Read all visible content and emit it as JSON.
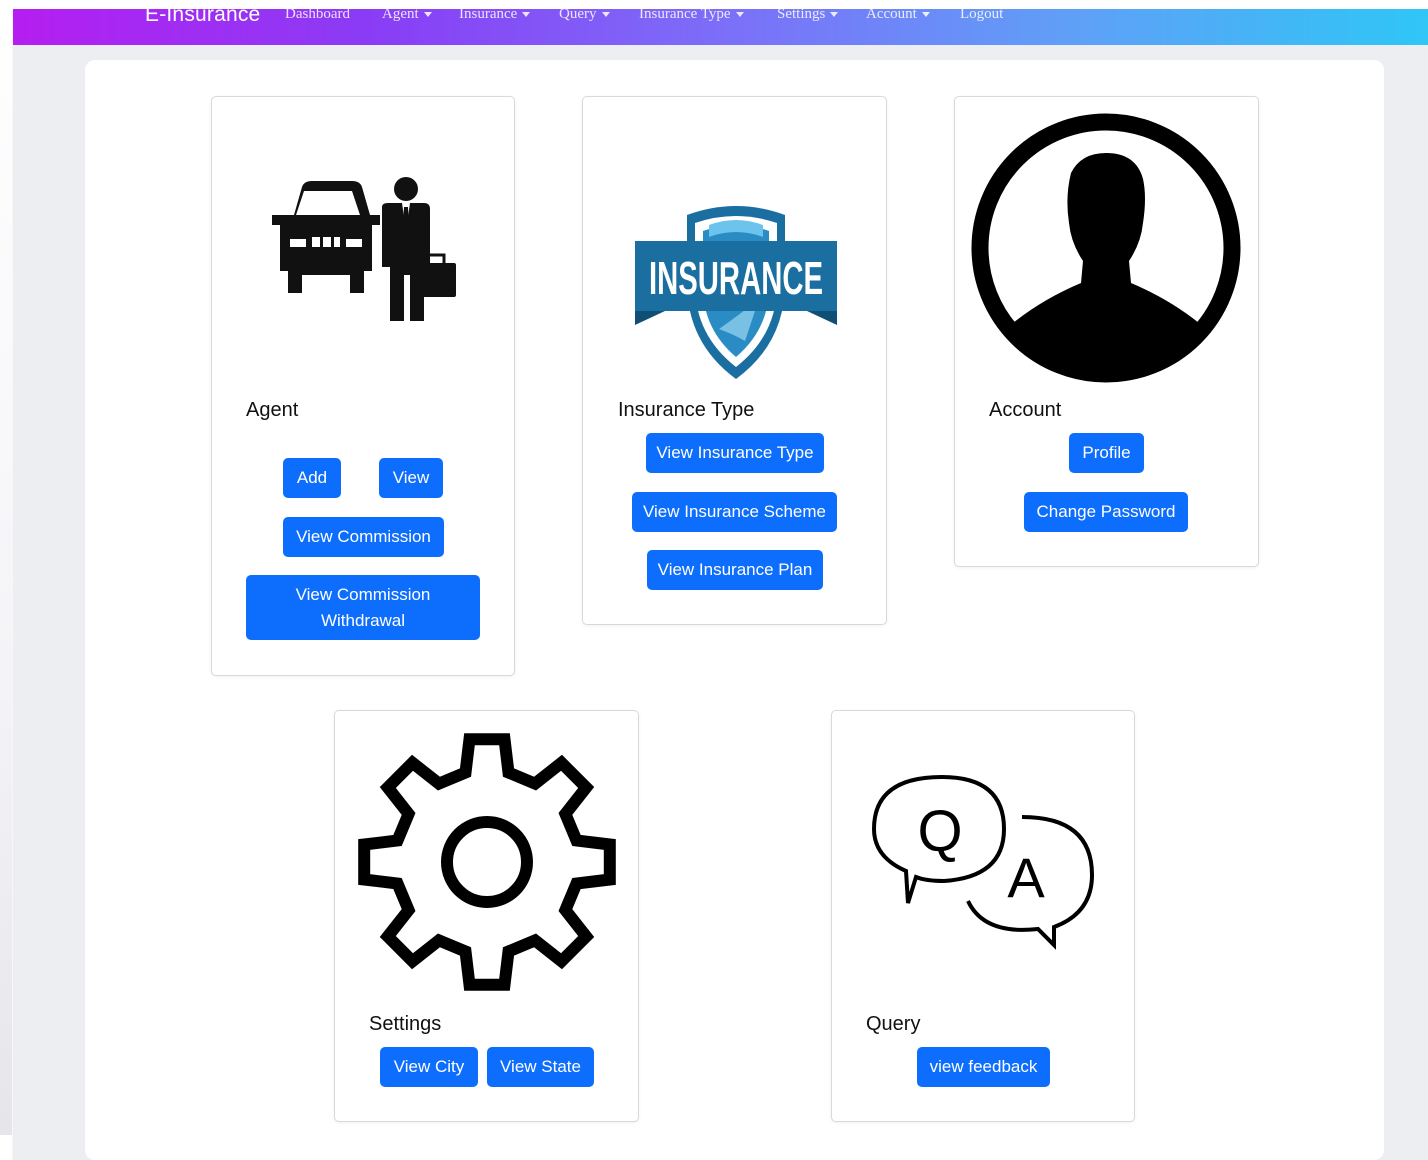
{
  "navbar": {
    "brand": "E-Insurance",
    "links": [
      {
        "label": "Dashboard",
        "dropdown": false
      },
      {
        "label": "Agent",
        "dropdown": true
      },
      {
        "label": "Insurance",
        "dropdown": true
      },
      {
        "label": "Query",
        "dropdown": true
      },
      {
        "label": "Insurance Type",
        "dropdown": true
      },
      {
        "label": "Settings",
        "dropdown": true
      },
      {
        "label": "Account",
        "dropdown": true
      },
      {
        "label": "Logout",
        "dropdown": false
      }
    ]
  },
  "cards": {
    "agent": {
      "title": "Agent",
      "icon": "car-agent-icon",
      "buttons": {
        "add": "Add",
        "view": "View",
        "view_commission": "View Commission",
        "withdrawal_line1": "View Commission",
        "withdrawal_line2": "Withdrawal"
      }
    },
    "insurance_type": {
      "title": "Insurance Type",
      "icon": "insurance-shield-icon",
      "logo_text": "INSURANCE",
      "buttons": {
        "view_type": "View Insurance Type",
        "view_scheme": "View Insurance Scheme",
        "view_plan": "View Insurance Plan"
      }
    },
    "account": {
      "title": "Account",
      "icon": "user-avatar-icon",
      "buttons": {
        "profile": "Profile",
        "change_password": "Change Password"
      }
    },
    "settings": {
      "title": "Settings",
      "icon": "gear-icon",
      "buttons": {
        "view_city": "View City",
        "view_state": "View State"
      }
    },
    "query": {
      "title": "Query",
      "icon": "qa-chat-icon",
      "bubble_q": "Q",
      "bubble_a": "A",
      "buttons": {
        "view_feedback": "view feedback"
      }
    }
  },
  "colors": {
    "primary_button": "#0d6efd",
    "navbar_start": "#b51ef0",
    "navbar_end": "#2fc6f6",
    "insurance_blue": "#1b6fa0"
  }
}
